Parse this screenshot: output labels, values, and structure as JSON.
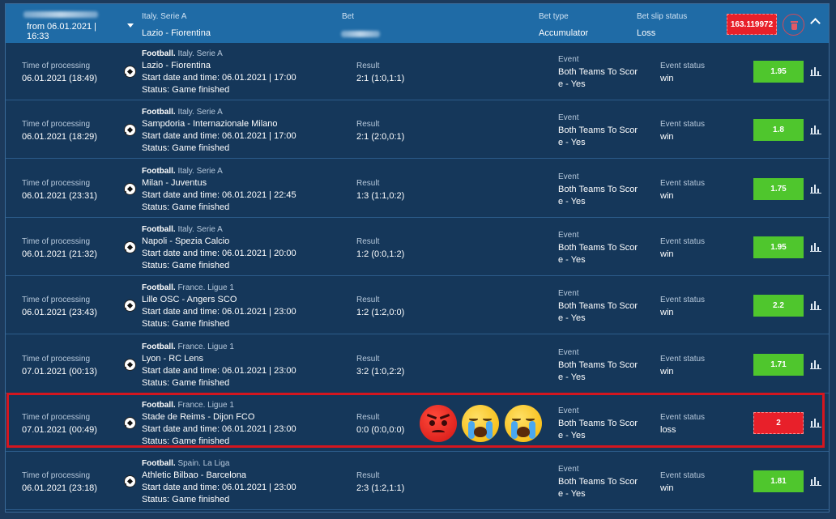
{
  "header": {
    "from_date": "from 06.01.2021 |",
    "from_time": "16:33",
    "league": "Italy. Serie A",
    "match": "Lazio - Fiorentina",
    "bet_label": "Bet",
    "bet_type_label": "Bet type",
    "bet_type_value": "Accumulator",
    "slip_status_label": "Bet slip status",
    "slip_status_value": "Loss",
    "amount": "163.119972"
  },
  "labels": {
    "time_of_processing": "Time of processing",
    "result": "Result",
    "event": "Event",
    "event_status": "Event status",
    "event_line1": "Both Teams To Scor",
    "event_line2": "e - Yes",
    "start_prefix": "Start date and time: ",
    "status": "Status: Game finished"
  },
  "rows": [
    {
      "processing": "06.01.2021 (18:49)",
      "sport": "Football.",
      "league": "Italy. Serie A",
      "match": "Lazio - Fiorentina",
      "start": "Start date and time: 06.01.2021 | 17:00",
      "status": "Status: Game finished",
      "result": "2:1 (1:0,1:1)",
      "event_line1": "Both Teams To Scor",
      "event_line2": "e - Yes",
      "event_status": "win",
      "odd": "1.95",
      "loss": false
    },
    {
      "processing": "06.01.2021 (18:29)",
      "sport": "Football.",
      "league": "Italy. Serie A",
      "match": "Sampdoria - Internazionale Milano",
      "start": "Start date and time: 06.01.2021 | 17:00",
      "status": "Status: Game finished",
      "result": "2:1 (2:0,0:1)",
      "event_line1": "Both Teams To Scor",
      "event_line2": "e - Yes",
      "event_status": "win",
      "odd": "1.8",
      "loss": false
    },
    {
      "processing": "06.01.2021 (23:31)",
      "sport": "Football.",
      "league": "Italy. Serie A",
      "match": "Milan - Juventus",
      "start": "Start date and time: 06.01.2021 | 22:45",
      "status": "Status: Game finished",
      "result": "1:3 (1:1,0:2)",
      "event_line1": "Both Teams To Scor",
      "event_line2": "e - Yes",
      "event_status": "win",
      "odd": "1.75",
      "loss": false
    },
    {
      "processing": "06.01.2021 (21:32)",
      "sport": "Football.",
      "league": "Italy. Serie A",
      "match": "Napoli - Spezia Calcio",
      "start": "Start date and time: 06.01.2021 | 20:00",
      "status": "Status: Game finished",
      "result": "1:2 (0:0,1:2)",
      "event_line1": "Both Teams To Scor",
      "event_line2": "e - Yes",
      "event_status": "win",
      "odd": "1.95",
      "loss": false
    },
    {
      "processing": "06.01.2021 (23:43)",
      "sport": "Football.",
      "league": "France. Ligue 1",
      "match": "Lille OSC - Angers SCO",
      "start": "Start date and time: 06.01.2021 | 23:00",
      "status": "Status: Game finished",
      "result": "1:2 (1:2,0:0)",
      "event_line1": "Both Teams To Scor",
      "event_line2": "e - Yes",
      "event_status": "win",
      "odd": "2.2",
      "loss": false
    },
    {
      "processing": "07.01.2021 (00:13)",
      "sport": "Football.",
      "league": "France. Ligue 1",
      "match": "Lyon - RC Lens",
      "start": "Start date and time: 06.01.2021 | 23:00",
      "status": "Status: Game finished",
      "result": "3:2 (1:0,2:2)",
      "event_line1": "Both Teams To Scor",
      "event_line2": "e - Yes",
      "event_status": "win",
      "odd": "1.71",
      "loss": false
    },
    {
      "processing": "07.01.2021 (00:49)",
      "sport": "Football.",
      "league": "France. Ligue 1",
      "match": "Stade de Reims - Dijon FCO",
      "start": "Start date and time: 06.01.2021 | 23:00",
      "status": "Status: Game finished",
      "result": "0:0 (0:0,0:0)",
      "event_line1": "Both Teams To Scor",
      "event_line2": "e - Yes",
      "event_status": "loss",
      "odd": "2",
      "loss": true
    },
    {
      "processing": "06.01.2021 (23:18)",
      "sport": "Football.",
      "league": "Spain. La Liga",
      "match": "Athletic Bilbao - Barcelona",
      "start": "Start date and time: 06.01.2021 | 23:00",
      "status": "Status: Game finished",
      "result": "2:3 (1:2,1:1)",
      "event_line1": "Both Teams To Scor",
      "event_line2": "e - Yes",
      "event_status": "win",
      "odd": "1.81",
      "loss": false
    }
  ],
  "icons": {
    "ball": "football-icon",
    "stats": "stats-icon",
    "trash": "trash-icon",
    "expand": "chevron-down-icon",
    "collapse": "chevron-up-icon",
    "emojis": [
      "angry-face-icon",
      "crying-face-icon",
      "crying-face-icon"
    ]
  },
  "colors": {
    "header_bg": "#1f6ba6",
    "row_bg": "#15375a",
    "win_badge": "#4fc62d",
    "loss_badge": "#e8202a",
    "highlight_border": "#d4161f"
  }
}
